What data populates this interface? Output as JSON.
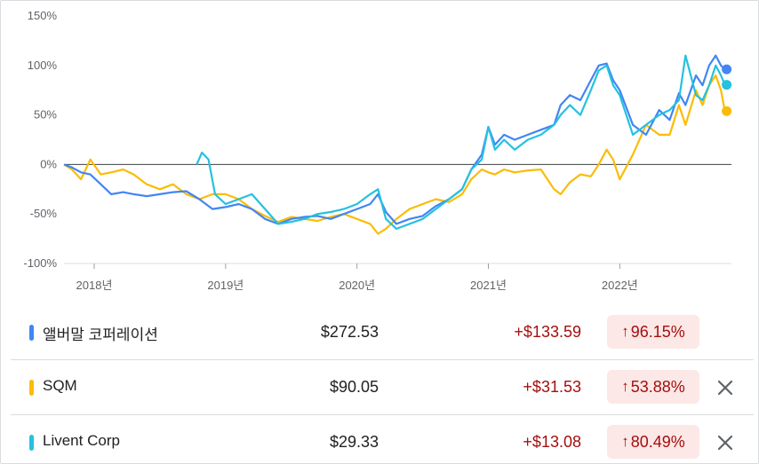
{
  "chart_data": {
    "type": "line",
    "ylim": [
      -100,
      150
    ],
    "y_ticks": [
      "150%",
      "100%",
      "50%",
      "0%",
      "-50%",
      "-100%"
    ],
    "y_tick_values": [
      150,
      100,
      50,
      0,
      -50,
      -100
    ],
    "x_tick_labels": [
      "2018년",
      "2019년",
      "2020년",
      "2021년",
      "2022년"
    ],
    "x_tick_values": [
      2018.0,
      2019.0,
      2020.0,
      2021.0,
      2022.0
    ],
    "xlim": [
      2017.77,
      2022.85
    ],
    "series": [
      {
        "name": "앨버말 코퍼레이션",
        "color": "#4285f4",
        "x": [
          2017.77,
          2017.83,
          2017.9,
          2017.97,
          2018.05,
          2018.13,
          2018.22,
          2018.3,
          2018.4,
          2018.5,
          2018.6,
          2018.7,
          2018.8,
          2018.9,
          2019.0,
          2019.1,
          2019.2,
          2019.3,
          2019.4,
          2019.5,
          2019.6,
          2019.7,
          2019.8,
          2019.9,
          2020.0,
          2020.1,
          2020.16,
          2020.22,
          2020.3,
          2020.4,
          2020.5,
          2020.6,
          2020.7,
          2020.8,
          2020.87,
          2020.95,
          2021.0,
          2021.05,
          2021.12,
          2021.2,
          2021.3,
          2021.4,
          2021.5,
          2021.55,
          2021.62,
          2021.7,
          2021.78,
          2021.84,
          2021.9,
          2021.95,
          2022.0,
          2022.1,
          2022.2,
          2022.3,
          2022.38,
          2022.45,
          2022.5,
          2022.58,
          2022.63,
          2022.68,
          2022.73,
          2022.77,
          2022.8
        ],
        "y": [
          0,
          -3,
          -8,
          -10,
          -20,
          -30,
          -28,
          -30,
          -32,
          -30,
          -28,
          -27,
          -35,
          -45,
          -43,
          -40,
          -45,
          -55,
          -60,
          -55,
          -53,
          -52,
          -55,
          -50,
          -45,
          -40,
          -30,
          -48,
          -60,
          -55,
          -52,
          -42,
          -35,
          -25,
          -5,
          10,
          38,
          20,
          30,
          25,
          30,
          35,
          40,
          60,
          70,
          65,
          85,
          100,
          102,
          85,
          75,
          40,
          30,
          55,
          45,
          72,
          60,
          90,
          80,
          100,
          110,
          100,
          96.15
        ]
      },
      {
        "name": "SQM",
        "color": "#fbbc04",
        "x": [
          2017.77,
          2017.83,
          2017.9,
          2017.97,
          2018.05,
          2018.13,
          2018.22,
          2018.3,
          2018.4,
          2018.5,
          2018.6,
          2018.7,
          2018.8,
          2018.9,
          2019.0,
          2019.1,
          2019.2,
          2019.3,
          2019.4,
          2019.5,
          2019.6,
          2019.7,
          2019.8,
          2019.9,
          2020.0,
          2020.1,
          2020.16,
          2020.22,
          2020.3,
          2020.4,
          2020.5,
          2020.6,
          2020.7,
          2020.8,
          2020.87,
          2020.95,
          2021.0,
          2021.05,
          2021.12,
          2021.2,
          2021.3,
          2021.4,
          2021.5,
          2021.55,
          2021.62,
          2021.7,
          2021.78,
          2021.84,
          2021.9,
          2021.95,
          2022.0,
          2022.1,
          2022.2,
          2022.3,
          2022.38,
          2022.45,
          2022.5,
          2022.58,
          2022.63,
          2022.68,
          2022.73,
          2022.77,
          2022.8
        ],
        "y": [
          0,
          -5,
          -15,
          5,
          -10,
          -8,
          -5,
          -10,
          -20,
          -25,
          -20,
          -30,
          -35,
          -30,
          -30,
          -35,
          -45,
          -52,
          -58,
          -53,
          -55,
          -57,
          -53,
          -50,
          -55,
          -60,
          -70,
          -65,
          -55,
          -45,
          -40,
          -35,
          -38,
          -30,
          -15,
          -5,
          -8,
          -10,
          -5,
          -8,
          -6,
          -5,
          -25,
          -30,
          -18,
          -10,
          -12,
          0,
          15,
          5,
          -15,
          10,
          40,
          30,
          30,
          60,
          40,
          75,
          60,
          80,
          90,
          75,
          53.88
        ]
      },
      {
        "name": "Livent Corp",
        "color": "#24c1e0",
        "x": [
          2018.78,
          2018.82,
          2018.87,
          2018.92,
          2019.0,
          2019.1,
          2019.2,
          2019.3,
          2019.4,
          2019.5,
          2019.6,
          2019.7,
          2019.8,
          2019.9,
          2020.0,
          2020.1,
          2020.16,
          2020.22,
          2020.3,
          2020.4,
          2020.5,
          2020.6,
          2020.7,
          2020.8,
          2020.87,
          2020.95,
          2021.0,
          2021.05,
          2021.12,
          2021.2,
          2021.3,
          2021.4,
          2021.5,
          2021.55,
          2021.62,
          2021.7,
          2021.78,
          2021.84,
          2021.9,
          2021.95,
          2022.0,
          2022.1,
          2022.2,
          2022.3,
          2022.38,
          2022.45,
          2022.5,
          2022.58,
          2022.63,
          2022.68,
          2022.73,
          2022.77,
          2022.8
        ],
        "y": [
          0,
          12,
          5,
          -30,
          -40,
          -35,
          -30,
          -45,
          -60,
          -58,
          -55,
          -50,
          -48,
          -45,
          -40,
          -30,
          -25,
          -55,
          -65,
          -60,
          -55,
          -45,
          -35,
          -25,
          -5,
          5,
          38,
          15,
          25,
          15,
          25,
          30,
          40,
          50,
          60,
          50,
          75,
          95,
          100,
          80,
          70,
          30,
          40,
          50,
          55,
          65,
          110,
          70,
          65,
          80,
          100,
          90,
          80.49
        ]
      }
    ]
  },
  "rows": [
    {
      "name": "앨버말 코퍼레이션",
      "price": "$272.53",
      "change": "+$133.59",
      "pct": "96.15%",
      "color": "#4285f4",
      "removable": false
    },
    {
      "name": "SQM",
      "price": "$90.05",
      "change": "+$31.53",
      "pct": "53.88%",
      "color": "#fbbc04",
      "removable": true
    },
    {
      "name": "Livent Corp",
      "price": "$29.33",
      "change": "+$13.08",
      "pct": "80.49%",
      "color": "#24c1e0",
      "removable": true
    }
  ],
  "icons": {
    "arrow": "arrow-up-icon",
    "close": "close-icon"
  }
}
